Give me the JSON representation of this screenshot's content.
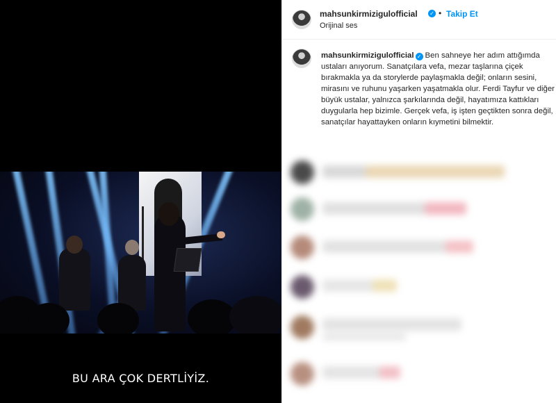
{
  "media": {
    "subtitle": "BU ARA ÇOK DERTLİYİZ."
  },
  "header": {
    "username": "mahsunkirmizigulofficial",
    "separator": "•",
    "follow_label": "Takip Et",
    "audio_label": "Orijinal ses"
  },
  "post": {
    "username": "mahsunkirmizigulofficial",
    "text": "Ben sahneye her adım attığımda ustaları anıyorum. Sanatçılara vefa, mezar taşlarına çiçek bırakmakla ya da storylerde paylaşmakla değil; onların sesini, mirasını ve ruhunu yaşarken yaşatmakla olur. Ferdi Tayfur ve diğer büyük ustalar, yalnızca şarkılarında değil, hayatımıza kattıkları duygularla hep bizimle. Gerçek vefa, iş işten geçtikten sonra değil, sanatçılar hayattayken onların kıymetini bilmektir."
  },
  "icons": {
    "verified": "verified-check-icon"
  },
  "colors": {
    "accent": "#0095f6",
    "text": "#262626"
  }
}
